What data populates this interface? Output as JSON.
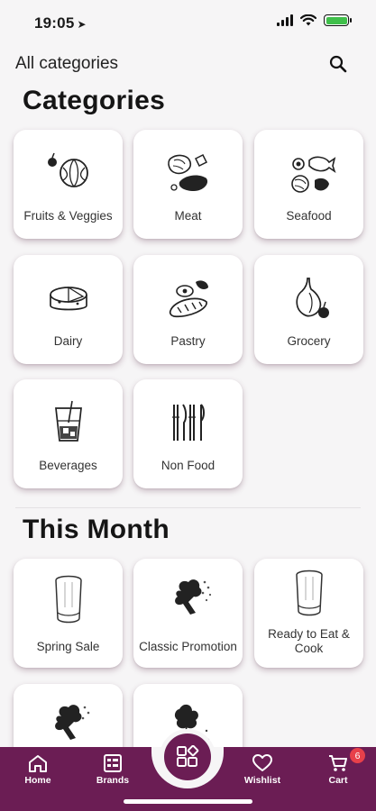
{
  "status_bar": {
    "time": "19:05",
    "location_glyph": "➤"
  },
  "header": {
    "title": "All categories",
    "search_icon": "search-icon"
  },
  "sections": {
    "categories_title": "Categories",
    "month_title": "This Month"
  },
  "categories": [
    {
      "label": "Fruits & Veggies",
      "icon": "fruits-veggies-icon"
    },
    {
      "label": "Meat",
      "icon": "meat-icon"
    },
    {
      "label": "Seafood",
      "icon": "seafood-icon"
    },
    {
      "label": "Dairy",
      "icon": "dairy-icon"
    },
    {
      "label": "Pastry",
      "icon": "pastry-icon"
    },
    {
      "label": "Grocery",
      "icon": "grocery-icon"
    },
    {
      "label": "Beverages",
      "icon": "beverages-icon"
    },
    {
      "label": "Non Food",
      "icon": "non-food-icon"
    }
  ],
  "this_month": [
    {
      "label": "Spring Sale",
      "icon": "chef-hat-icon"
    },
    {
      "label": "Classic Promotion",
      "icon": "broccoli-icon"
    },
    {
      "label": "Ready to Eat & Cook",
      "icon": "chef-hat-icon"
    },
    {
      "label": "",
      "icon": "broccoli-icon"
    },
    {
      "label": "",
      "icon": "herbs-icon"
    }
  ],
  "bottom_nav": {
    "home": "Home",
    "brands": "Brands",
    "wishlist": "Wishlist",
    "cart": "Cart",
    "cart_count": "6"
  },
  "colors": {
    "brand": "#6b1d54",
    "badge": "#e8404a",
    "background": "#f6f5f6"
  }
}
